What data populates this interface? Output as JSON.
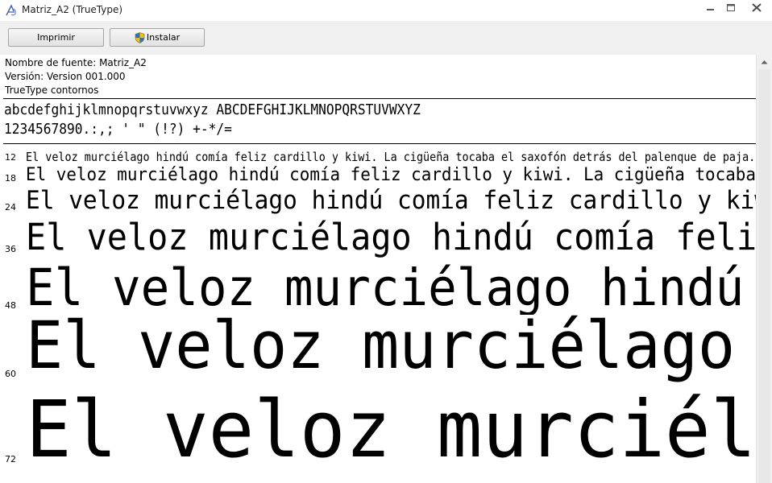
{
  "window": {
    "title": "Matriz_A2 (TrueType)",
    "app_icon": "font-viewer-icon",
    "controls": [
      "minimize-icon",
      "maximize-icon",
      "close-icon"
    ]
  },
  "toolbar": {
    "print_label": "Imprimir",
    "install_label": "Instalar",
    "install_icon": "uac-shield-icon"
  },
  "font_info": {
    "name_line": "Nombre de fuente: Matriz_A2",
    "version_line": "Versión: Version 001.000",
    "type_line": "TrueType  contornos"
  },
  "charset": {
    "line1": "abcdefghijklmnopqrstuvwxyz ABCDEFGHIJKLMNOPQRSTUVWXYZ",
    "line2": "1234567890.:,; ' \" (!?) +-*/="
  },
  "sample": {
    "sentence": "El veloz murciélago hindú comía feliz cardillo y kiwi. La cigüeña tocaba el saxofón detrás del palenque de paja.",
    "sizes": [
      {
        "label": "12",
        "text": "El veloz murciélago hindú comía feliz cardillo y kiwi. La cigüeña tocaba el saxofón detrás del palenque de paja."
      },
      {
        "label": "18",
        "text": "El veloz murciélago hindú comía feliz cardillo y kiwi. La cigüeña tocaba el"
      },
      {
        "label": "24",
        "text": "El veloz murciélago hindú comía feliz cardillo y kiwi. La"
      },
      {
        "label": "36",
        "text": "El veloz murciélago hindú comía feliz"
      },
      {
        "label": "48",
        "text": "El veloz murciélago hindú co"
      },
      {
        "label": "60",
        "text": "El veloz murciélago hin"
      },
      {
        "label": "72",
        "text": "El veloz murciélago"
      }
    ]
  }
}
